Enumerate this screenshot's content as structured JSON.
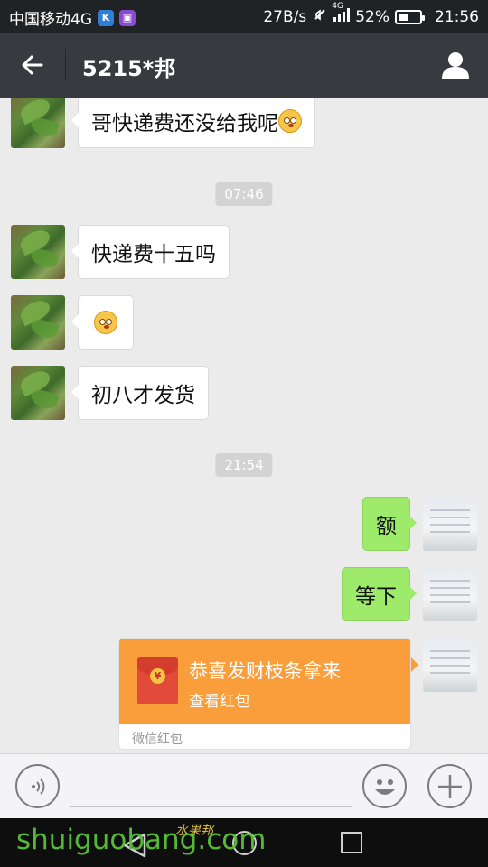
{
  "status_bar": {
    "carrier": "中国移动4G",
    "net_speed": "27B/s",
    "network_label": "4G",
    "battery": "52%",
    "battery_level": 0.52,
    "time": "21:56"
  },
  "header": {
    "title": "5215*邦"
  },
  "messages": [
    {
      "side": "in",
      "text": "哥快递费还没给我呢",
      "has_emoji": true
    },
    {
      "timestamp": "07:46"
    },
    {
      "side": "in",
      "text": "快递费十五吗"
    },
    {
      "side": "in",
      "text": "",
      "has_emoji": true
    },
    {
      "side": "in",
      "text": "初八才发货"
    },
    {
      "timestamp": "21:54"
    },
    {
      "side": "out",
      "text": "额"
    },
    {
      "side": "out",
      "text": "等下"
    }
  ],
  "red_packet": {
    "title": "恭喜发财枝条拿来",
    "action": "查看红包",
    "footer": "微信红包",
    "coin_symbol": "¥"
  },
  "watermark": {
    "text": "shuiguobang.com",
    "cn": "水果邦"
  },
  "icons": {
    "back": "arrow-left-icon",
    "profile": "person-icon",
    "voice": "voice-icon",
    "emoji": "emoji-icon",
    "plus": "plus-icon"
  },
  "colors": {
    "header_bg": "#393a3f",
    "chat_bg": "#ebebeb",
    "outgoing_bubble": "#9eea6a",
    "red_packet": "#fa9d3b"
  }
}
